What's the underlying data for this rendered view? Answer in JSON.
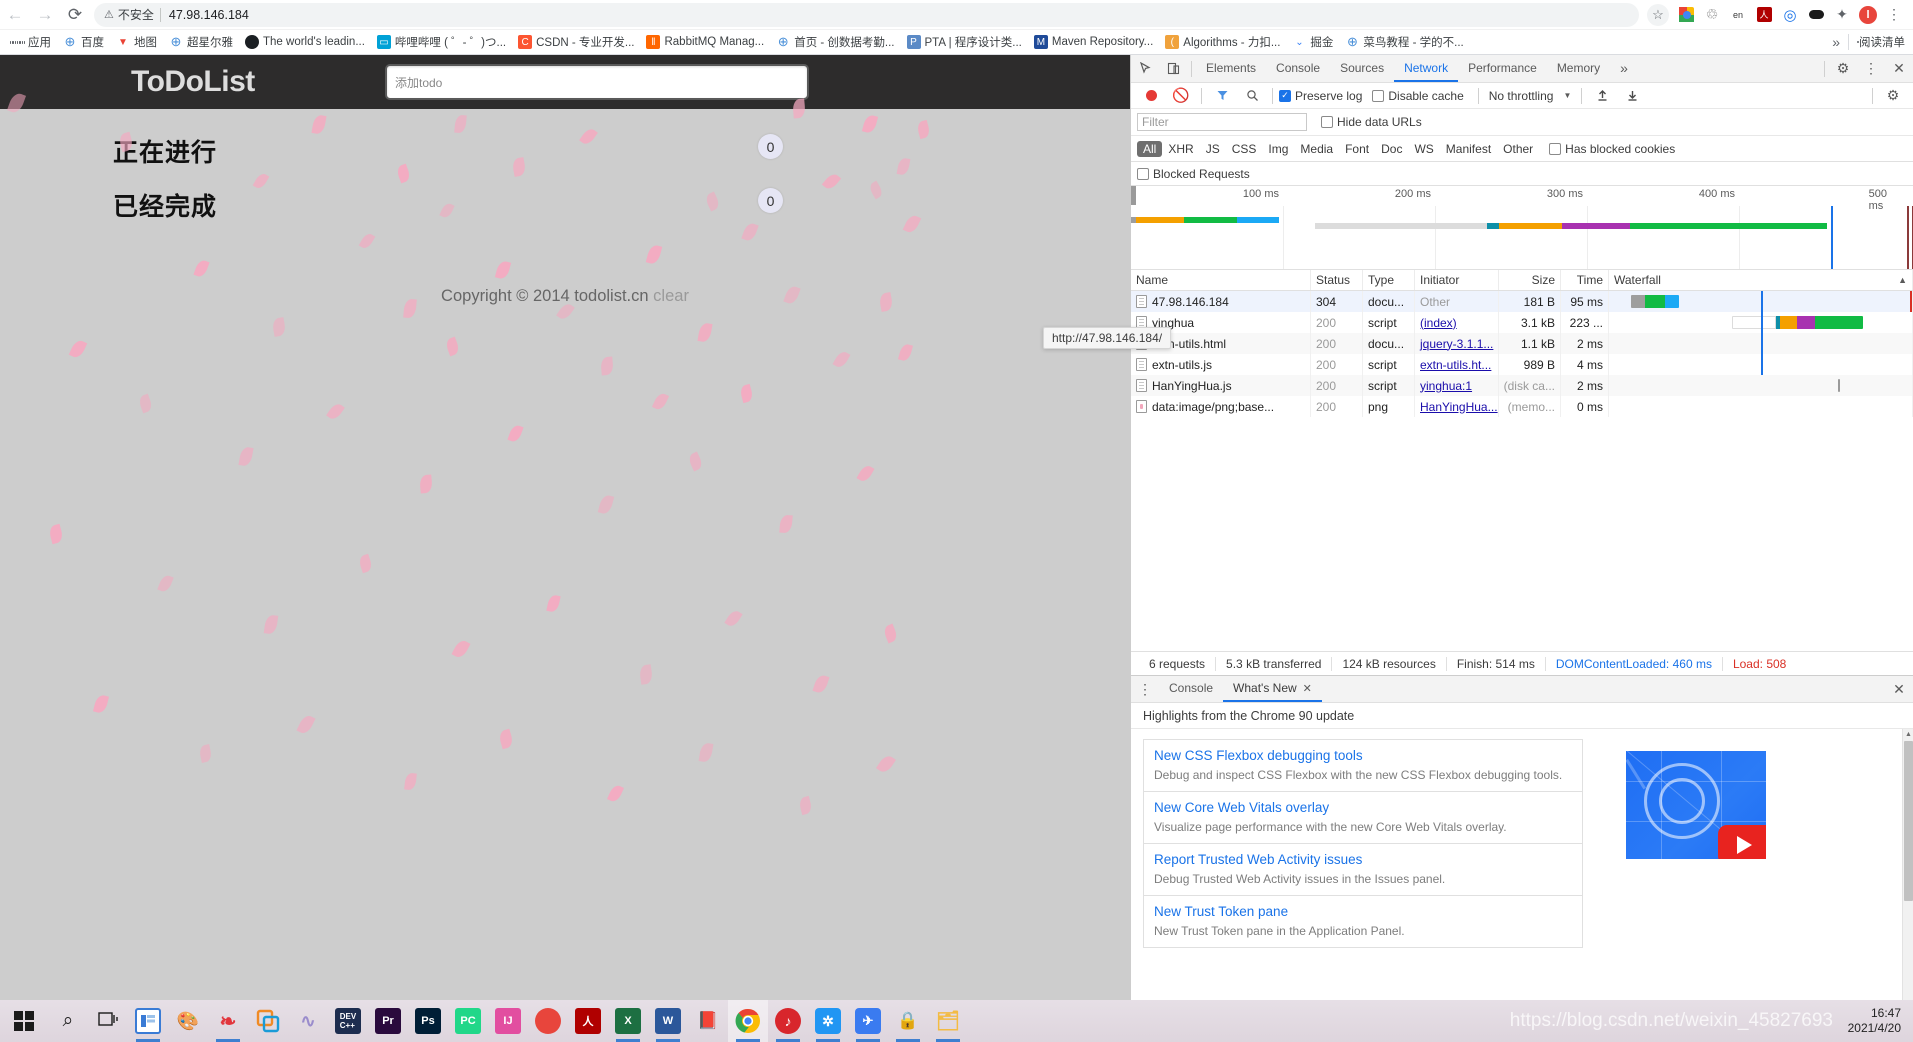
{
  "browser": {
    "nav": {
      "back": "←",
      "forward": "→",
      "reload": "⟳"
    },
    "omnibox": {
      "security_icon": "warning-triangle-icon",
      "security_label": "不安全",
      "url": "47.98.146.184"
    },
    "toolbar_icons": [
      {
        "name": "bookmark-star-icon",
        "glyph": "☆"
      },
      {
        "name": "chrome-download-extension-icon",
        "glyph": ""
      },
      {
        "name": "recycle-extension-icon",
        "glyph": "♲"
      },
      {
        "name": "translate-extension-icon",
        "glyph": "en"
      },
      {
        "name": "acrobat-extension-icon",
        "glyph": "人"
      },
      {
        "name": "blue-ring-extension-icon",
        "glyph": "◎"
      },
      {
        "name": "momo-extension-icon",
        "glyph": "••"
      },
      {
        "name": "puzzle-extensions-icon",
        "glyph": "✦"
      },
      {
        "name": "profile-avatar-icon",
        "glyph": "l"
      },
      {
        "name": "chrome-menu-icon",
        "glyph": "⋮"
      }
    ],
    "bookmarks": [
      {
        "label": "应用",
        "icon": "apps-grid-icon",
        "color": "#4285f4"
      },
      {
        "label": "百度",
        "icon": "globe-icon",
        "color": "#4a90d9"
      },
      {
        "label": "地图",
        "icon": "map-pin-icon",
        "color": "#ea4335"
      },
      {
        "label": "超星尔雅",
        "icon": "globe-icon",
        "color": "#4a90d9"
      },
      {
        "label": "The world's leadin...",
        "icon": "github-icon",
        "color": "#1b1f23"
      },
      {
        "label": "哔哩哔哩 ( ゜- ゜)つ...",
        "icon": "bilibili-icon",
        "color": "#00a1d6"
      },
      {
        "label": "CSDN - 专业开发...",
        "icon": "csdn-icon",
        "color": "#fc5531"
      },
      {
        "label": "RabbitMQ Manag...",
        "icon": "rabbitmq-icon",
        "color": "#ff6600"
      },
      {
        "label": "首页 - 创数据考勤...",
        "icon": "globe-icon",
        "color": "#4a90d9"
      },
      {
        "label": "PTA | 程序设计类...",
        "icon": "pta-icon",
        "color": "#5b8ac6"
      },
      {
        "label": "Maven Repository...",
        "icon": "maven-icon",
        "color": "#1f4b99"
      },
      {
        "label": "Algorithms - 力扣...",
        "icon": "leetcode-icon",
        "color": "#f0a23c"
      },
      {
        "label": "掘金",
        "icon": "juejin-icon",
        "color": "#3b82f6"
      },
      {
        "label": "菜鸟教程 - 学的不...",
        "icon": "globe-icon",
        "color": "#4a90d9"
      }
    ],
    "bookmarks_overflow": "»",
    "reading_list": {
      "label": "阅读清单",
      "icon": "reading-list-icon"
    }
  },
  "page": {
    "title": "ToDoList",
    "input_placeholder": "添加todo",
    "input_value": "",
    "sections": [
      {
        "label": "正在进行",
        "count": "0"
      },
      {
        "label": "已经完成",
        "count": "0"
      }
    ],
    "footer_text": "Copyright © 2014 todolist.cn",
    "footer_clear": "clear"
  },
  "devtools": {
    "left_icons": [
      {
        "name": "inspect-element-icon",
        "glyph": "⬉"
      },
      {
        "name": "device-toolbar-icon",
        "glyph": "▯"
      }
    ],
    "tabs": [
      {
        "label": "Elements",
        "active": false
      },
      {
        "label": "Console",
        "active": false
      },
      {
        "label": "Sources",
        "active": false
      },
      {
        "label": "Network",
        "active": true
      },
      {
        "label": "Performance",
        "active": false
      },
      {
        "label": "Memory",
        "active": false
      }
    ],
    "tabs_overflow": "»",
    "right_icons": [
      {
        "name": "settings-gear-icon",
        "glyph": "⚙"
      },
      {
        "name": "devtools-menu-icon",
        "glyph": "⋮"
      },
      {
        "name": "close-devtools-icon",
        "glyph": "✕"
      }
    ],
    "network_toolbar": {
      "record_icon": "record-stop-icon",
      "clear_icon": "clear-network-icon",
      "filter_icon": "filter-funnel-icon",
      "search_icon": "search-icon",
      "preserve_log": {
        "label": "Preserve log",
        "checked": true
      },
      "disable_cache": {
        "label": "Disable cache",
        "checked": false
      },
      "throttling": "No throttling",
      "throttling_caret": "▼",
      "import_icon": "import-har-icon",
      "export_icon": "export-har-icon",
      "network_settings_icon": "network-settings-gear-icon"
    },
    "filter_bar": {
      "placeholder": "Filter",
      "value": "",
      "hide_data_urls": {
        "label": "Hide data URLs",
        "checked": false
      }
    },
    "type_filters": [
      {
        "label": "All",
        "selected": true
      },
      {
        "label": "XHR",
        "selected": false
      },
      {
        "label": "JS",
        "selected": false
      },
      {
        "label": "CSS",
        "selected": false
      },
      {
        "label": "Img",
        "selected": false
      },
      {
        "label": "Media",
        "selected": false
      },
      {
        "label": "Font",
        "selected": false
      },
      {
        "label": "Doc",
        "selected": false
      },
      {
        "label": "WS",
        "selected": false
      },
      {
        "label": "Manifest",
        "selected": false
      },
      {
        "label": "Other",
        "selected": false
      }
    ],
    "has_blocked_cookies": {
      "label": "Has blocked cookies",
      "checked": false
    },
    "blocked_requests": {
      "label": "Blocked Requests",
      "checked": false
    },
    "overview": {
      "ticks": [
        "100 ms",
        "200 ms",
        "300 ms",
        "400 ms",
        "500 ms"
      ],
      "dcl_color": "#1a73e8",
      "load_color": "#d93025"
    },
    "table": {
      "columns": [
        "Name",
        "Status",
        "Type",
        "Initiator",
        "Size",
        "Time",
        "Waterfall"
      ],
      "sort_caret": "▲",
      "rows": [
        {
          "name": "47.98.146.184",
          "status": "304",
          "type": "docu...",
          "initiator": "Other",
          "initiator_link": false,
          "size": "181 B",
          "time": "95 ms",
          "icon": "document-icon",
          "selected": true
        },
        {
          "name": "yinghua",
          "status": "200",
          "type": "script",
          "initiator": "(index)",
          "initiator_link": true,
          "size": "3.1 kB",
          "time": "223 ...",
          "icon": "document-icon",
          "selected": false
        },
        {
          "name": "extn-utils.html",
          "status": "200",
          "type": "docu...",
          "initiator": "jquery-3.1.1...",
          "initiator_link": true,
          "size": "1.1 kB",
          "time": "2 ms",
          "icon": "document-icon",
          "selected": false
        },
        {
          "name": "extn-utils.js",
          "status": "200",
          "type": "script",
          "initiator": "extn-utils.ht...",
          "initiator_link": true,
          "size": "989 B",
          "time": "4 ms",
          "icon": "document-icon",
          "selected": false
        },
        {
          "name": "HanYingHua.js",
          "status": "200",
          "type": "script",
          "initiator": "yinghua:1",
          "initiator_link": true,
          "size": "(disk ca...",
          "time": "2 ms",
          "icon": "document-icon",
          "selected": false
        },
        {
          "name": "data:image/png;base...",
          "status": "200",
          "type": "png",
          "initiator": "HanYingHua...",
          "initiator_link": true,
          "size": "(memo...",
          "time": "0 ms",
          "icon": "image-icon",
          "selected": false
        }
      ]
    },
    "summary": [
      {
        "text": "6 requests",
        "style": "normal"
      },
      {
        "text": "5.3 kB transferred",
        "style": "normal"
      },
      {
        "text": "124 kB resources",
        "style": "normal"
      },
      {
        "text": "Finish: 514 ms",
        "style": "normal"
      },
      {
        "text": "DOMContentLoaded: 460 ms",
        "style": "blue"
      },
      {
        "text": "Load: 508",
        "style": "red"
      }
    ],
    "tooltip": "http://47.98.146.184/",
    "drawer": {
      "menu_icon": "drawer-menu-icon",
      "tabs": [
        {
          "label": "Console",
          "active": false,
          "closable": false
        },
        {
          "label": "What's New",
          "active": true,
          "closable": true,
          "close_glyph": "✕"
        }
      ],
      "close_icon": "close-drawer-icon",
      "subtitle": "Highlights from the Chrome 90 update",
      "cards": [
        {
          "title": "New CSS Flexbox debugging tools",
          "desc": "Debug and inspect CSS Flexbox with the new CSS Flexbox debugging tools."
        },
        {
          "title": "New Core Web Vitals overlay",
          "desc": "Visualize page performance with the new Core Web Vitals overlay."
        },
        {
          "title": "Report Trusted Web Activity issues",
          "desc": "Debug Trusted Web Activity issues in the Issues panel."
        },
        {
          "title": "New Trust Token pane",
          "desc": "New Trust Token pane in the Application Panel."
        }
      ],
      "thumbnail": "chrome-devtools-video-thumbnail"
    }
  },
  "taskbar": {
    "items": [
      {
        "name": "start-button",
        "icon": "windows-logo-icon",
        "label": "",
        "color": "#1b1b1b"
      },
      {
        "name": "search-button",
        "icon": "search-icon",
        "label": "⌕",
        "color": "#1b1b1b"
      },
      {
        "name": "task-view-button",
        "icon": "task-view-icon",
        "label": "",
        "color": "#1b1b1b"
      },
      {
        "name": "file-explorer-pinned",
        "icon": "window-icon",
        "label": "",
        "color": "#3a7bd5",
        "running": true
      },
      {
        "name": "paint-pinned",
        "icon": "paint-palette-icon",
        "label": "",
        "color": "#d8b4e2"
      },
      {
        "name": "navicat-pinned",
        "icon": "navicat-icon",
        "label": "",
        "color": "#e2353c",
        "running": true
      },
      {
        "name": "vmware-pinned",
        "icon": "vmware-icon",
        "label": "",
        "color": "#f08a24"
      },
      {
        "name": "mysql-workbench-pinned",
        "icon": "dolphin-icon",
        "label": "",
        "color": "#9a8ccc"
      },
      {
        "name": "devcpp-pinned",
        "icon": "devcpp-icon",
        "label": "DEV",
        "color": "#1d2d4f"
      },
      {
        "name": "premiere-pinned",
        "icon": "premiere-icon",
        "label": "Pr",
        "color": "#2a0a3d"
      },
      {
        "name": "photoshop-pinned",
        "icon": "photoshop-icon",
        "label": "Ps",
        "color": "#001e36"
      },
      {
        "name": "pycharm-pinned",
        "icon": "pycharm-icon",
        "label": "PC",
        "color": "#21d789"
      },
      {
        "name": "intellij-pinned",
        "icon": "intellij-icon",
        "label": "IJ",
        "color": "#e24ea0"
      },
      {
        "name": "opera-pinned",
        "icon": "opera-icon",
        "label": "",
        "color": "#e8453c"
      },
      {
        "name": "acrobat-pinned",
        "icon": "acrobat-icon",
        "label": "人",
        "color": "#b00000"
      },
      {
        "name": "excel-pinned",
        "icon": "excel-icon",
        "label": "X",
        "color": "#1d6f42",
        "running": true
      },
      {
        "name": "word-pinned",
        "icon": "word-icon",
        "label": "W",
        "color": "#2b579a",
        "running": true
      },
      {
        "name": "xmind-pinned",
        "icon": "notes-icon",
        "label": "",
        "color": "#e05c5c"
      },
      {
        "name": "chrome-active",
        "icon": "chrome-icon",
        "label": "",
        "color": "#4285f4",
        "running": true,
        "active": true
      },
      {
        "name": "netease-music-pinned",
        "icon": "netease-music-icon",
        "label": "",
        "color": "#d8262c",
        "running": true
      },
      {
        "name": "snipaste-pinned",
        "icon": "snipaste-icon",
        "label": "✲",
        "color": "#2196f3",
        "running": true
      },
      {
        "name": "foxmail-pinned",
        "icon": "foxmail-icon",
        "label": "",
        "color": "#3a7bf0",
        "running": true
      },
      {
        "name": "encrypt-pinned",
        "icon": "lock-icon",
        "label": "",
        "color": "#4a4a4a",
        "running": true
      },
      {
        "name": "wps-pinned",
        "icon": "folder-icon",
        "label": "",
        "color": "#f3bb43",
        "running": true
      }
    ],
    "watermark": "https://blog.csdn.net/weixin_45827693",
    "clock_time": "16:47",
    "clock_date": "2021/4/20"
  }
}
